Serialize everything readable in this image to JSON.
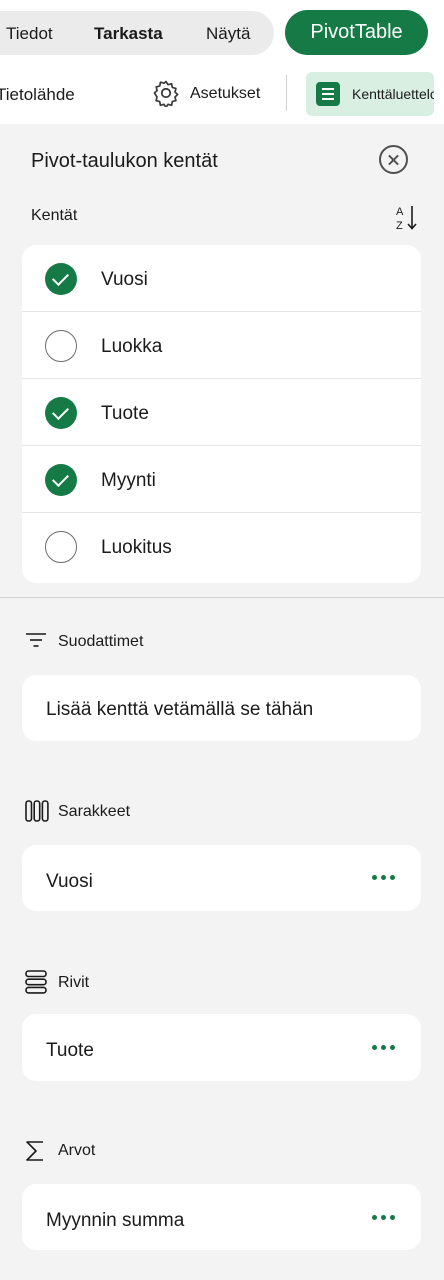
{
  "ribbon": {
    "tabs": [
      {
        "label": "Tiedot"
      },
      {
        "label": "Tarkasta"
      },
      {
        "label": "Näytä"
      }
    ],
    "active_tab": "PivotTable",
    "tools": {
      "data_source": "Tietolähde",
      "settings": "Asetukset",
      "field_list": "Kenttäluettelo"
    }
  },
  "panel": {
    "title": "Pivot-taulukon kentät",
    "fields_label": "Kentät",
    "fields": [
      {
        "name": "Vuosi",
        "checked": true
      },
      {
        "name": "Luokka",
        "checked": false
      },
      {
        "name": "Tuote",
        "checked": true
      },
      {
        "name": "Myynti",
        "checked": true
      },
      {
        "name": "Luokitus",
        "checked": false
      }
    ],
    "filters": {
      "label": "Suodattimet",
      "placeholder": "Lisää kenttä vetämällä se tähän"
    },
    "columns": {
      "label": "Sarakkeet",
      "value": "Vuosi"
    },
    "rows": {
      "label": "Rivit",
      "value": "Tuote"
    },
    "values": {
      "label": "Arvot",
      "value": "Myynnin summa"
    }
  },
  "colors": {
    "accent": "#157a46",
    "accent_light": "#d9efe2",
    "background": "#f3f3f3"
  },
  "icons": [
    "settings-gear-icon",
    "field-list-icon",
    "close-icon",
    "sort-az-icon",
    "check-icon",
    "filter-icon",
    "columns-icon",
    "rows-icon",
    "sigma-icon",
    "more-icon"
  ]
}
